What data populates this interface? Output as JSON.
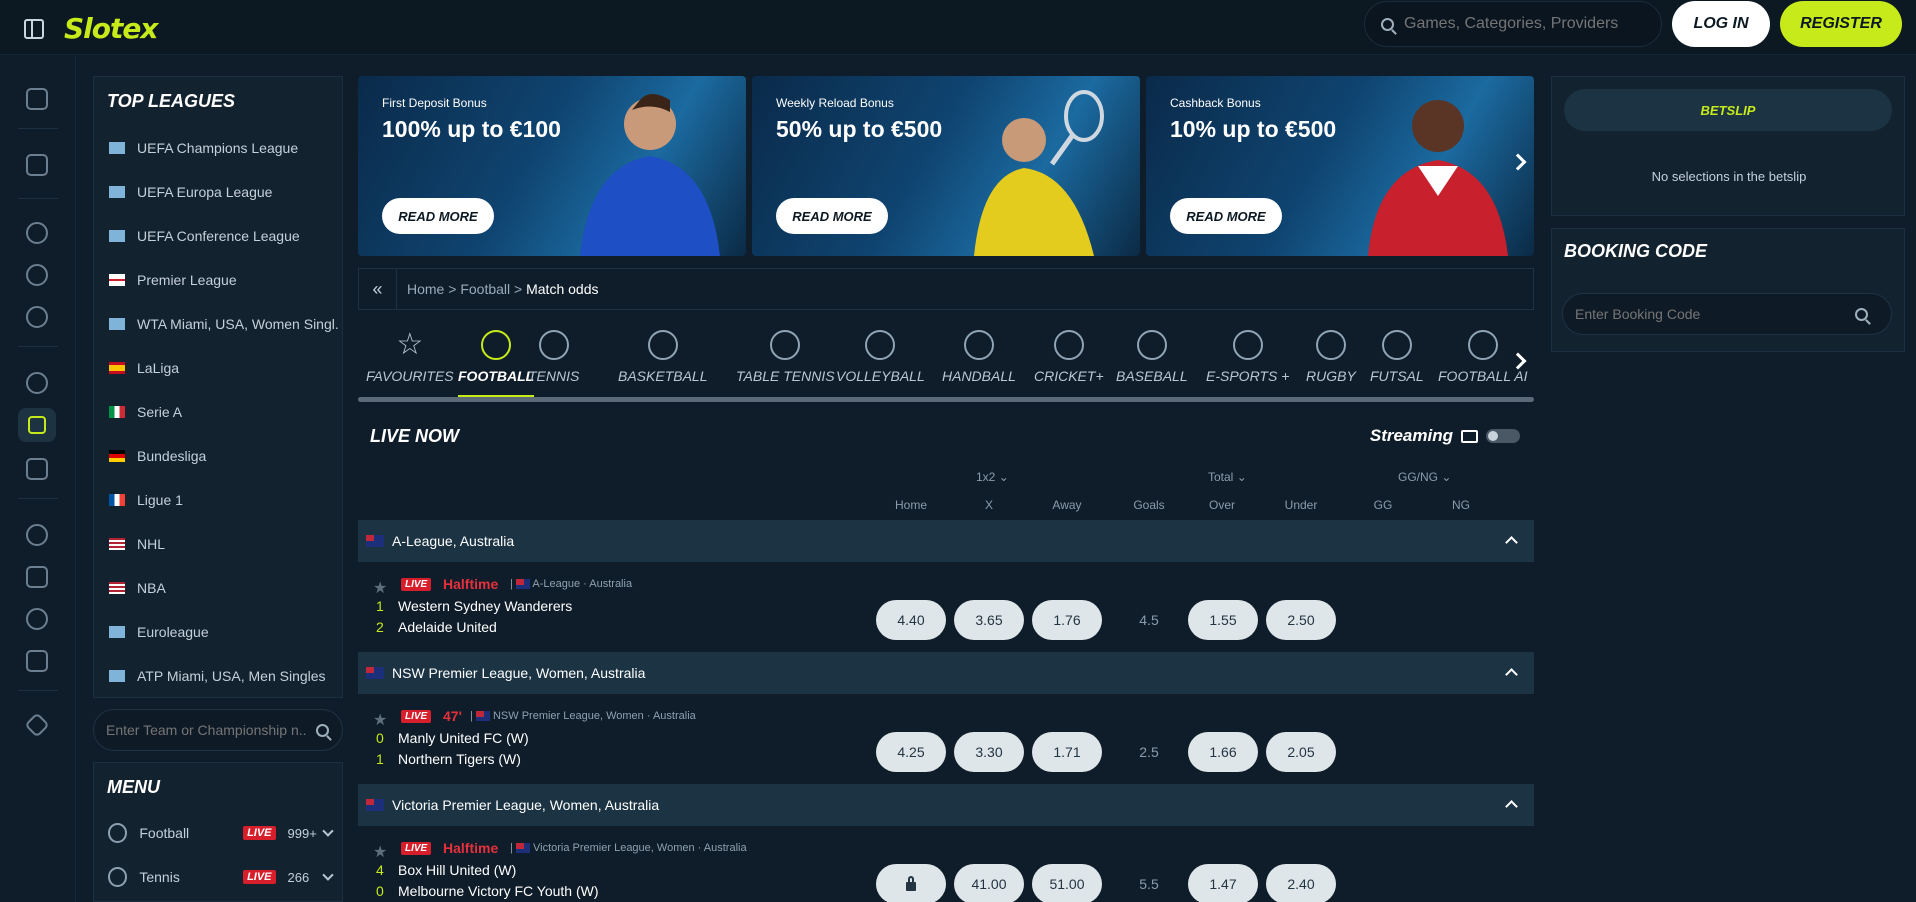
{
  "brand": {
    "logo": "Slotex"
  },
  "header": {
    "search_placeholder": "Games, Categories, Providers",
    "login_label": "LOG IN",
    "register_label": "REGISTER"
  },
  "rail_icons": [
    "casino-icon",
    "home-icon",
    "roulette-icon",
    "poker-icon",
    "help-circle-icon",
    "sports-ball-icon",
    "live-play-icon",
    "gamepad-icon",
    "lightbulb-icon",
    "trophy-icon",
    "promo-icon",
    "store-icon",
    "diamond-icon"
  ],
  "top_leagues": {
    "title": "TOP LEAGUES",
    "items": [
      {
        "label": "UEFA Champions League",
        "flag": "intl"
      },
      {
        "label": "UEFA Europa League",
        "flag": "intl"
      },
      {
        "label": "UEFA Conference League",
        "flag": "intl"
      },
      {
        "label": "Premier League",
        "flag": "england"
      },
      {
        "label": "WTA Miami, USA, Women Singl...",
        "flag": "intl"
      },
      {
        "label": "LaLiga",
        "flag": "spain"
      },
      {
        "label": "Serie A",
        "flag": "italy"
      },
      {
        "label": "Bundesliga",
        "flag": "germany"
      },
      {
        "label": "Ligue 1",
        "flag": "france"
      },
      {
        "label": "NHL",
        "flag": "usa"
      },
      {
        "label": "NBA",
        "flag": "usa"
      },
      {
        "label": "Euroleague",
        "flag": "intl"
      },
      {
        "label": "ATP Miami, USA, Men Singles",
        "flag": "intl"
      }
    ]
  },
  "team_search": {
    "placeholder": "Enter Team or Championship n..."
  },
  "menu": {
    "title": "MENU",
    "items": [
      {
        "label": "Football",
        "live": "LIVE",
        "count": "999+"
      },
      {
        "label": "Tennis",
        "live": "LIVE",
        "count": "266"
      }
    ]
  },
  "banners": [
    {
      "subtitle": "First Deposit Bonus",
      "title": "100% up to €100",
      "button": "READ MORE"
    },
    {
      "subtitle": "Weekly Reload Bonus",
      "title": "50% up to €500",
      "button": "READ MORE"
    },
    {
      "subtitle": "Cashback Bonus",
      "title": "10% up to €500",
      "button": "READ MORE"
    }
  ],
  "breadcrumb": {
    "home": "Home",
    "sep": ">",
    "section": "Football",
    "current": "Match odds"
  },
  "sports": [
    {
      "label": "FAVOURITES",
      "icon": "star-icon",
      "active": false
    },
    {
      "label": "FOOTBALL",
      "icon": "football-icon",
      "active": true
    },
    {
      "label": "TENNIS",
      "icon": "tennis-icon",
      "active": false
    },
    {
      "label": "BASKETBALL",
      "icon": "basketball-icon",
      "active": false
    },
    {
      "label": "TABLE TENNIS",
      "icon": "table-tennis-icon",
      "active": false
    },
    {
      "label": "VOLLEYBALL",
      "icon": "volleyball-icon",
      "active": false
    },
    {
      "label": "HANDBALL",
      "icon": "handball-icon",
      "active": false
    },
    {
      "label": "CRICKET+",
      "icon": "cricket-icon",
      "active": false
    },
    {
      "label": "BASEBALL",
      "icon": "baseball-icon",
      "active": false
    },
    {
      "label": "E-SPORTS +",
      "icon": "esports-icon",
      "active": false
    },
    {
      "label": "RUGBY",
      "icon": "rugby-icon",
      "active": false
    },
    {
      "label": "FUTSAL",
      "icon": "futsal-icon",
      "active": false
    },
    {
      "label": "FOOTBALL AI",
      "icon": "football-ai-icon",
      "active": false
    }
  ],
  "live": {
    "title": "LIVE NOW",
    "streaming_label": "Streaming",
    "groups": {
      "g1": "1x2",
      "g2": "Total",
      "g3": "GG/NG"
    },
    "columns": {
      "home": "Home",
      "x": "X",
      "away": "Away",
      "goals": "Goals",
      "over": "Over",
      "under": "Under",
      "gg": "GG",
      "ng": "NG"
    },
    "leagues": [
      {
        "name": "A-League, Australia",
        "match": {
          "live": "LIVE",
          "status": "Halftime",
          "meta_league": "A-League",
          "meta_country": "Australia",
          "home_score": "1",
          "home": "Western Sydney Wanderers",
          "away_score": "2",
          "away": "Adelaide United",
          "odds": {
            "home": "4.40",
            "x": "3.65",
            "away": "1.76",
            "goals": "4.5",
            "over": "1.55",
            "under": "2.50"
          }
        }
      },
      {
        "name": "NSW Premier League, Women, Australia",
        "match": {
          "live": "LIVE",
          "status": "47'",
          "meta_league": "NSW Premier League, Women",
          "meta_country": "Australia",
          "home_score": "0",
          "home": "Manly United FC (W)",
          "away_score": "1",
          "away": "Northern Tigers (W)",
          "odds": {
            "home": "4.25",
            "x": "3.30",
            "away": "1.71",
            "goals": "2.5",
            "over": "1.66",
            "under": "2.05"
          }
        }
      },
      {
        "name": "Victoria Premier League, Women, Australia",
        "match": {
          "live": "LIVE",
          "status": "Halftime",
          "meta_league": "Victoria Premier League, Women",
          "meta_country": "Australia",
          "home_score": "4",
          "home": "Box Hill United (W)",
          "away_score": "0",
          "away": "Melbourne Victory FC Youth (W)",
          "odds": {
            "home": "locked",
            "x": "41.00",
            "away": "51.00",
            "goals": "5.5",
            "over": "1.47",
            "under": "2.40"
          }
        }
      }
    ]
  },
  "betslip": {
    "tab": "BETSLIP",
    "empty": "No selections in the betslip"
  },
  "booking": {
    "title": "BOOKING CODE",
    "placeholder": "Enter Booking Code"
  },
  "colors": {
    "accent": "#c6ea1a",
    "live": "#d71f2c",
    "bg": "#0f1d2a"
  }
}
